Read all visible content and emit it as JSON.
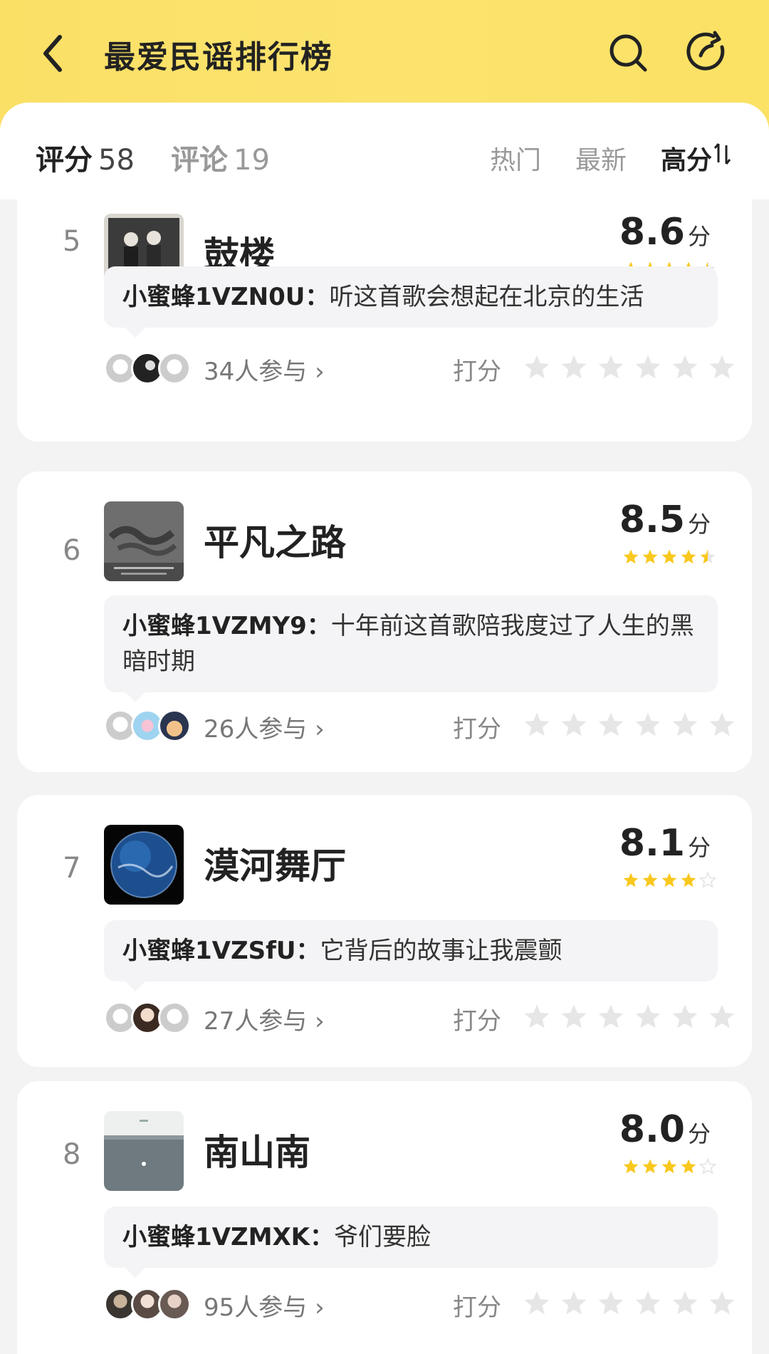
{
  "header": {
    "title": "最爱民谣排行榜",
    "bg_color": "#fbe066"
  },
  "tabs": {
    "score_label": "评分",
    "score_count": "58",
    "comment_label": "评论",
    "comment_count": "19",
    "sort_hot": "热门",
    "sort_new": "最新",
    "sort_high": "高分"
  },
  "items": [
    {
      "rank": "5",
      "title": "鼓楼",
      "score": "8.6",
      "unit": "分",
      "stars": 4.5,
      "comment_user": "小蜜蜂1VZN0U：",
      "comment_text": "听这首歌会想起在北京的生活",
      "participants": "34人参与",
      "rate_label": "打分"
    },
    {
      "rank": "6",
      "title": "平凡之路",
      "score": "8.5",
      "unit": "分",
      "stars": 4.5,
      "comment_user": "小蜜蜂1VZMY9：",
      "comment_text": "十年前这首歌陪我度过了人生的黑暗时期",
      "participants": "26人参与",
      "rate_label": "打分"
    },
    {
      "rank": "7",
      "title": "漠河舞厅",
      "score": "8.1",
      "unit": "分",
      "stars": 4,
      "comment_user": "小蜜蜂1VZSfU：",
      "comment_text": "它背后的故事让我震颤",
      "participants": "27人参与",
      "rate_label": "打分"
    },
    {
      "rank": "8",
      "title": "南山南",
      "score": "8.0",
      "unit": "分",
      "stars": 4,
      "comment_user": "小蜜蜂1VZMXK：",
      "comment_text": "爷们要脸",
      "participants": "95人参与",
      "rate_label": "打分"
    }
  ],
  "colors": {
    "star_filled": "#f9c81e",
    "star_empty": "#e6e6e6"
  }
}
